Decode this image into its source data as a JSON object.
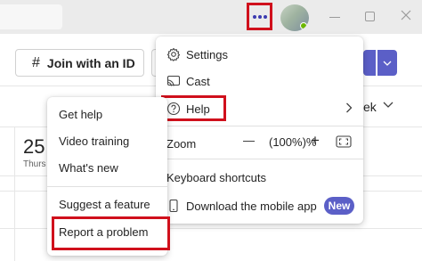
{
  "titlebar": {
    "more_icon": "more-horizontal-icon",
    "avatar_status_color": "#6bb700"
  },
  "toolbar": {
    "join_label": "Join with an ID",
    "join_icon": "hash-icon",
    "week_label": "ek"
  },
  "calendar": {
    "day_number": "25",
    "day_name": "Thurs"
  },
  "main_menu": {
    "settings": "Settings",
    "cast": "Cast",
    "help": "Help",
    "zoom_label": "Zoom",
    "zoom_minus": "—",
    "zoom_value": "(100%)%",
    "zoom_plus": "+",
    "keyboard_shortcuts": "Keyboard shortcuts",
    "download_mobile": "Download the mobile app",
    "new_badge": "New"
  },
  "sub_menu": {
    "get_help": "Get help",
    "video_training": "Video training",
    "whats_new": "What's new",
    "suggest_feature": "Suggest a feature",
    "report_problem": "Report a problem"
  },
  "colors": {
    "accent": "#5b5fc7",
    "highlight": "#d0101c"
  }
}
